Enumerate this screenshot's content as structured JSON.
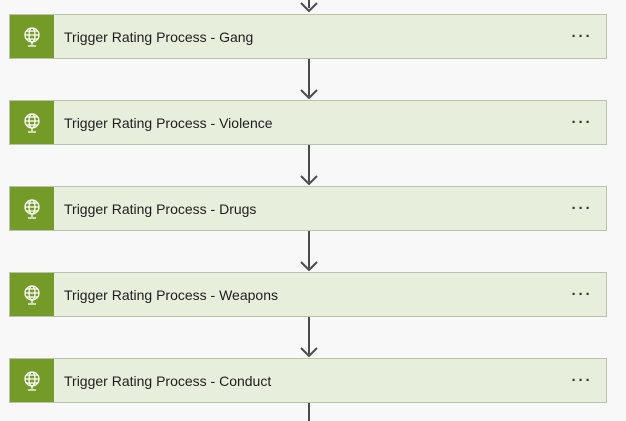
{
  "steps": [
    {
      "title": "Trigger Rating Process - Gang",
      "icon": "globe-icon",
      "menu_label": "···"
    },
    {
      "title": "Trigger Rating Process - Violence",
      "icon": "globe-icon",
      "menu_label": "···"
    },
    {
      "title": "Trigger Rating Process - Drugs",
      "icon": "globe-icon",
      "menu_label": "···"
    },
    {
      "title": "Trigger Rating Process - Weapons",
      "icon": "globe-icon",
      "menu_label": "···"
    },
    {
      "title": "Trigger Rating Process - Conduct",
      "icon": "globe-icon",
      "menu_label": "···"
    }
  ],
  "colors": {
    "icon_bg": "#749a28",
    "card_bg": "#e7efdc",
    "connector": "#4a4a4a"
  }
}
